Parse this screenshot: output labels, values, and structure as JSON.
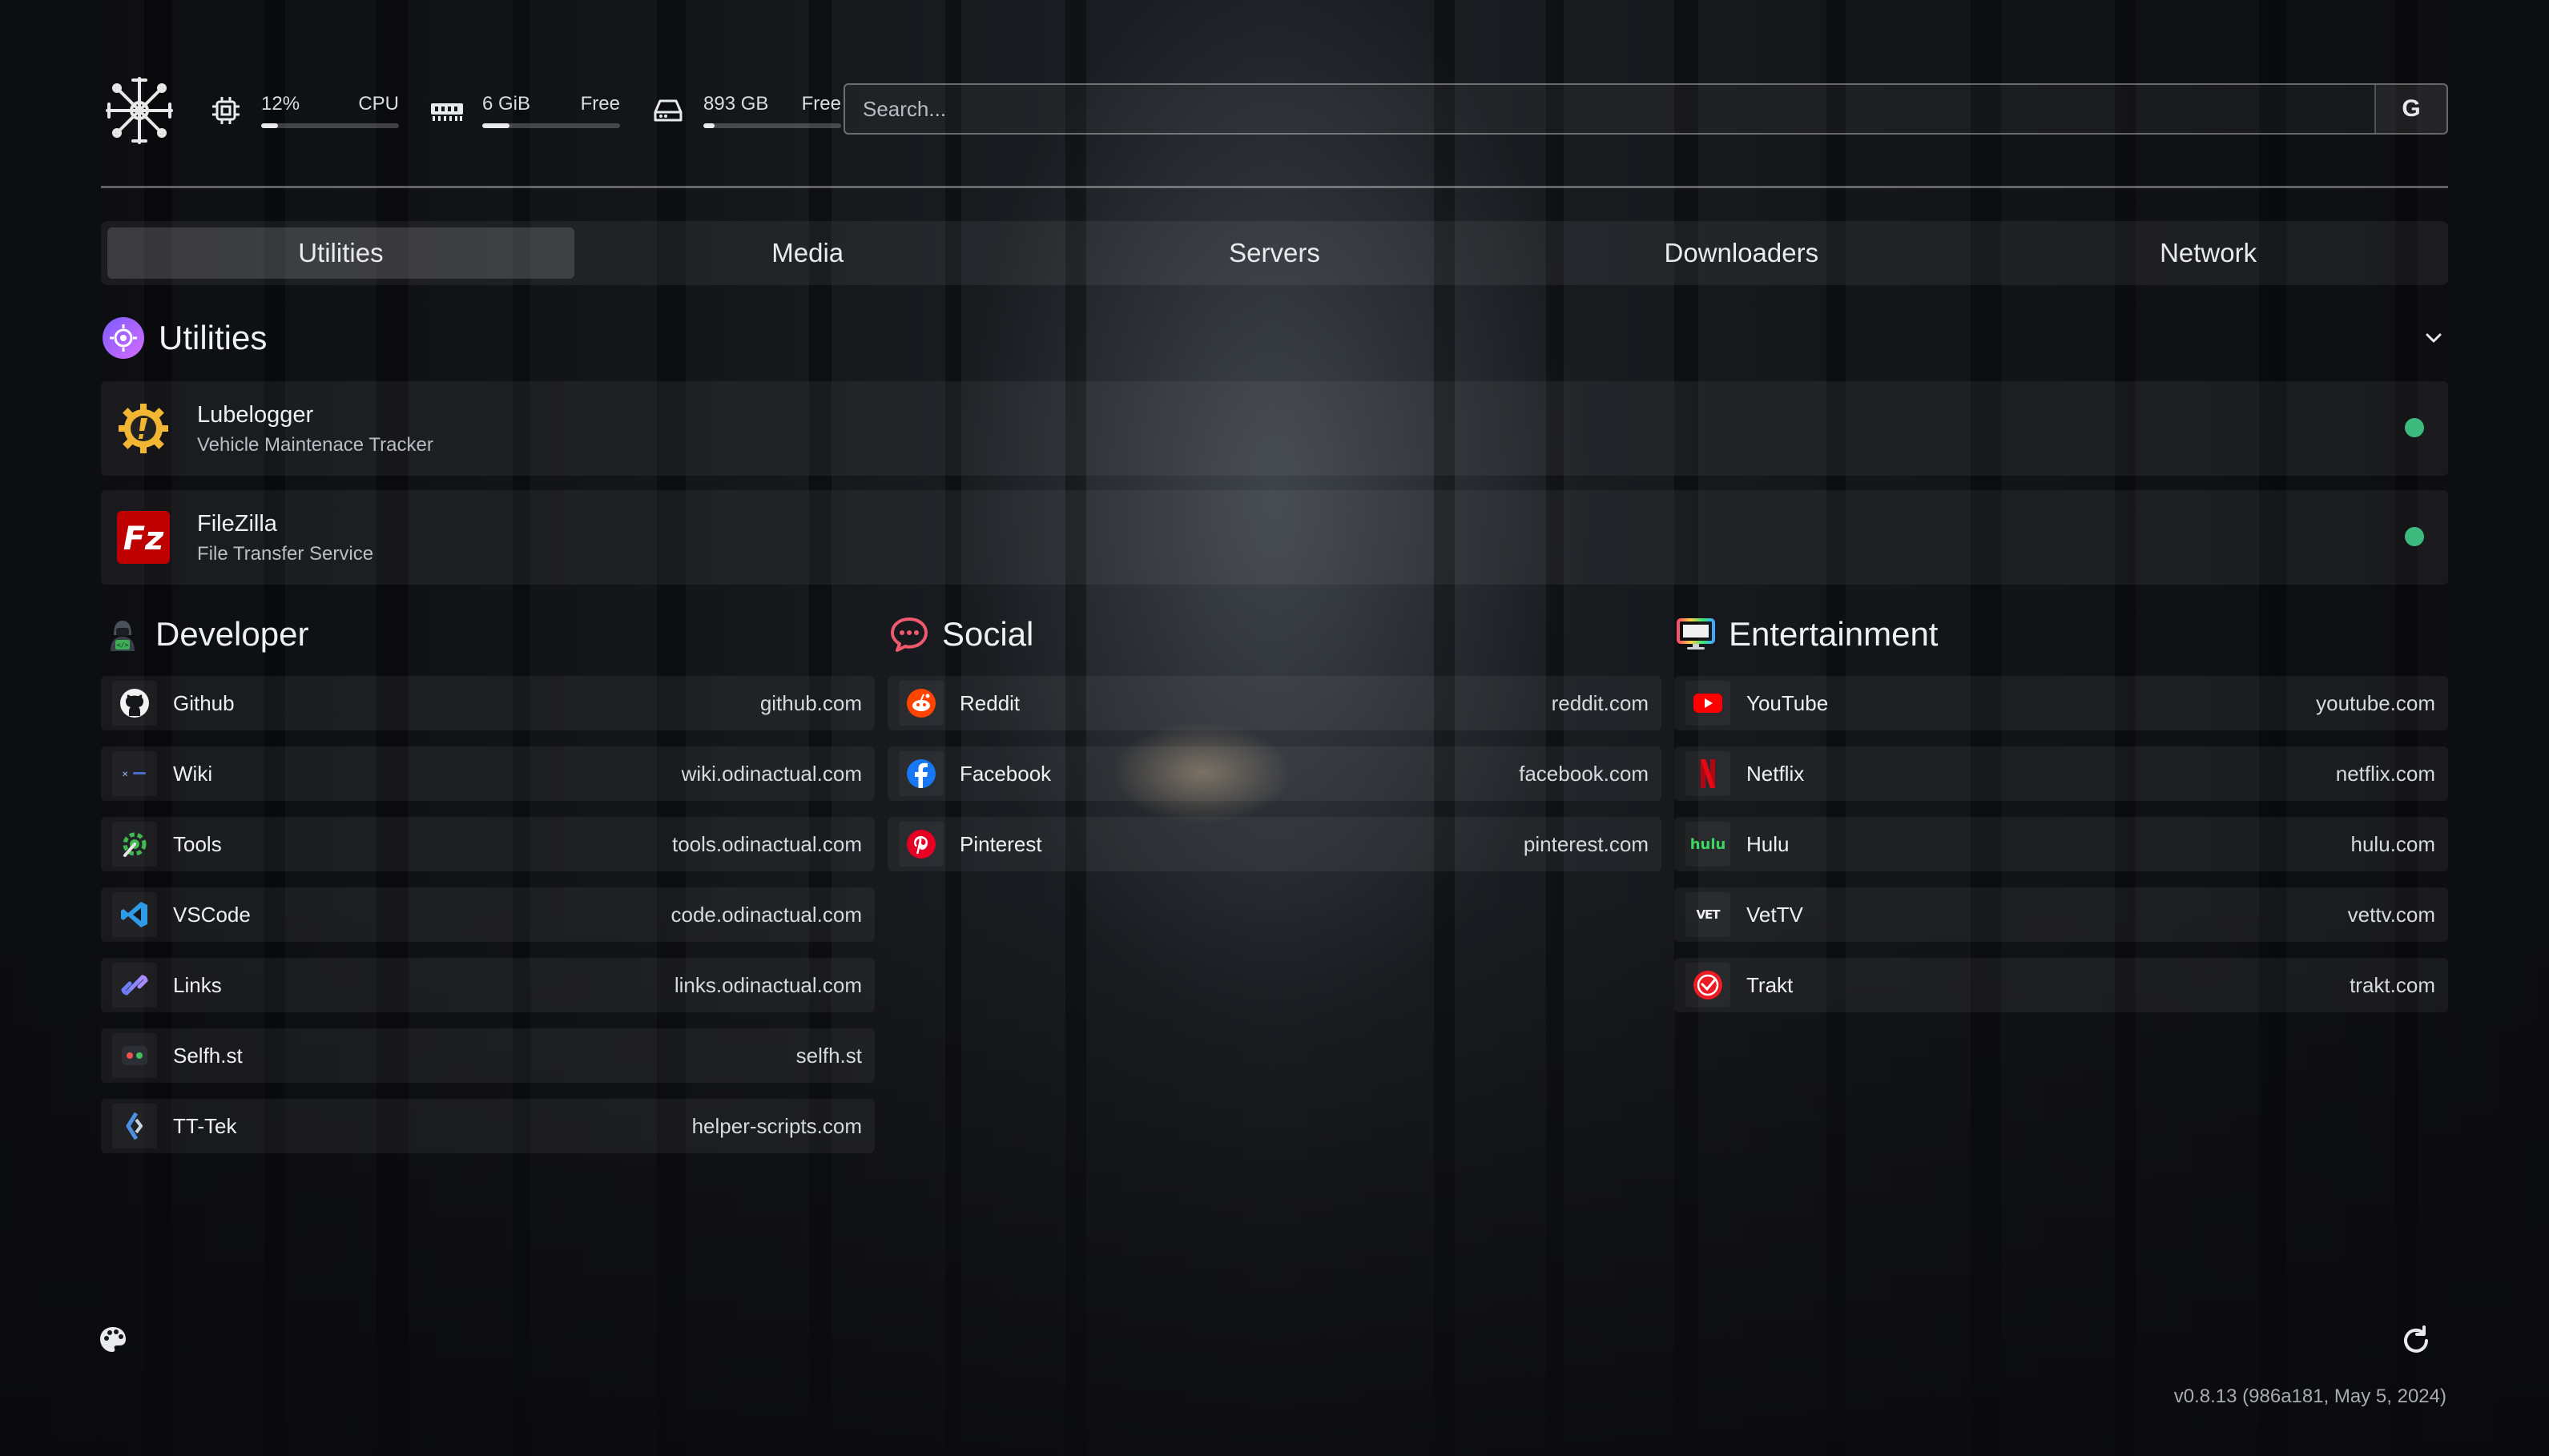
{
  "stats": {
    "cpu": {
      "value": "12%",
      "label": "CPU",
      "fraction": 0.12
    },
    "memory": {
      "value": "6 GiB",
      "label": "Free",
      "fraction": 0.2
    },
    "disk": {
      "value": "893 GB",
      "label": "Free",
      "fraction": 0.08
    }
  },
  "search": {
    "placeholder": "Search...",
    "provider_label": "G"
  },
  "tabs": [
    {
      "label": "Utilities",
      "active": true
    },
    {
      "label": "Media"
    },
    {
      "label": "Servers"
    },
    {
      "label": "Downloaders"
    },
    {
      "label": "Network"
    }
  ],
  "utilities": {
    "title": "Utilities",
    "services": [
      {
        "name": "Lubelogger",
        "description": "Vehicle Maintenace Tracker",
        "status_color": "#3dbb7e"
      },
      {
        "name": "FileZilla",
        "description": "File Transfer Service",
        "status_color": "#3dbb7e"
      }
    ]
  },
  "groups": {
    "developer": {
      "title": "Developer",
      "items": [
        {
          "name": "Github",
          "url": "github.com",
          "icon": "github-icon"
        },
        {
          "name": "Wiki",
          "url": "wiki.odinactual.com",
          "icon": "wiki-icon"
        },
        {
          "name": "Tools",
          "url": "tools.odinactual.com",
          "icon": "tools-icon"
        },
        {
          "name": "VSCode",
          "url": "code.odinactual.com",
          "icon": "vscode-icon"
        },
        {
          "name": "Links",
          "url": "links.odinactual.com",
          "icon": "link-icon"
        },
        {
          "name": "Selfh.st",
          "url": "selfh.st",
          "icon": "selfhst-icon"
        },
        {
          "name": "TT-Tek",
          "url": "helper-scripts.com",
          "icon": "tttek-icon"
        }
      ]
    },
    "social": {
      "title": "Social",
      "items": [
        {
          "name": "Reddit",
          "url": "reddit.com",
          "icon": "reddit-icon"
        },
        {
          "name": "Facebook",
          "url": "facebook.com",
          "icon": "facebook-icon"
        },
        {
          "name": "Pinterest",
          "url": "pinterest.com",
          "icon": "pinterest-icon"
        }
      ]
    },
    "entertainment": {
      "title": "Entertainment",
      "items": [
        {
          "name": "YouTube",
          "url": "youtube.com",
          "icon": "youtube-icon"
        },
        {
          "name": "Netflix",
          "url": "netflix.com",
          "icon": "netflix-icon"
        },
        {
          "name": "Hulu",
          "url": "hulu.com",
          "icon": "hulu-icon",
          "icon_text": "hulu"
        },
        {
          "name": "VetTV",
          "url": "vettv.com",
          "icon": "vettv-icon",
          "icon_text": "VET"
        },
        {
          "name": "Trakt",
          "url": "trakt.com",
          "icon": "trakt-icon"
        }
      ]
    }
  },
  "version": "v0.8.13 (986a181, May 5, 2024)"
}
